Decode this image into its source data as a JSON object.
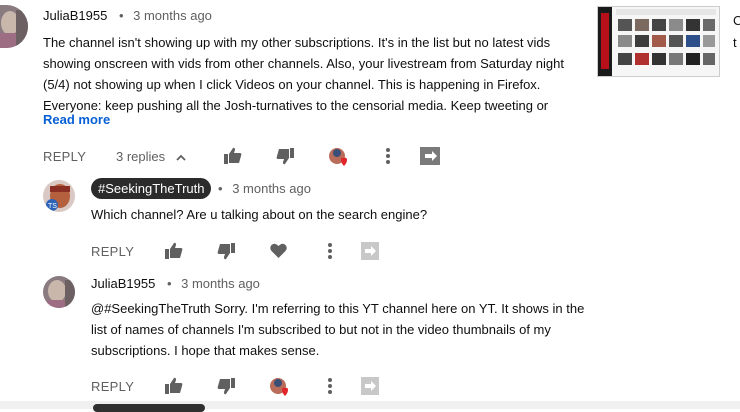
{
  "comment": {
    "author": "JuliaB1955",
    "time": "3 months ago",
    "text_lines": [
      "The channel isn't showing up with my other subscriptions. It's in the list but no latest vids",
      "showing onscreen with vids from other channels. Also, your livestream from Saturday night",
      "(5/4) not showing up when I click Videos on your channel. This is happening in Firefox.",
      "Everyone: keep pushing all the Josh-turnatives to the censorial media. Keep tweeting or"
    ],
    "read_more": "Read more",
    "reply_label": "REPLY",
    "replies_label": "3 replies"
  },
  "replies": [
    {
      "author": "#SeekingTheTruth",
      "time": "3 months ago",
      "text_lines": [
        "Which channel? Are u talking about on the search engine?"
      ],
      "reply_label": "REPLY"
    },
    {
      "author": "JuliaB1955",
      "time": "3 months ago",
      "text_lines": [
        "@#SeekingTheTruth Sorry. I'm referring to this YT channel here on YT. It shows in the",
        "list of names of channels I'm subscribed to but not in the video thumbnails of my",
        "subscriptions. I hope that makes sense."
      ],
      "reply_label": "REPLY"
    }
  ],
  "sidebar": {
    "side_text_lines": [
      "C",
      "t"
    ]
  },
  "colors": {
    "accent": "#065fd4",
    "muted": "#606060",
    "heart": "#e0262b",
    "badge_bg": "#2b2b2b"
  },
  "icons": [
    "thumbs-up-icon",
    "thumbs-down-icon",
    "heart-icon",
    "more-options-icon",
    "share-icon",
    "chevron-up-icon",
    "creator-heart-icon"
  ]
}
